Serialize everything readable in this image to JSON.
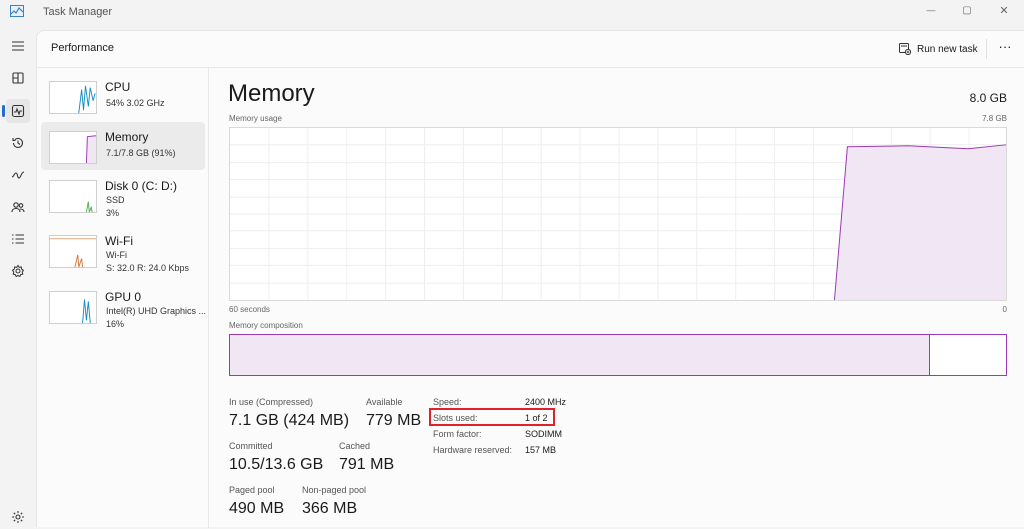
{
  "app": {
    "title": "Task Manager"
  },
  "window_controls": {
    "minimize": "—",
    "maximize": "▢",
    "close": "✕"
  },
  "nav": {
    "items": [
      {
        "name": "hamburger-menu-icon"
      },
      {
        "name": "processes-icon"
      },
      {
        "name": "performance-icon",
        "active": true
      },
      {
        "name": "app-history-icon"
      },
      {
        "name": "startup-apps-icon"
      },
      {
        "name": "users-icon"
      },
      {
        "name": "details-icon"
      },
      {
        "name": "services-icon"
      },
      {
        "name": "settings-icon"
      }
    ]
  },
  "header": {
    "title": "Performance",
    "run_new_task": "Run new task",
    "more": "···"
  },
  "sidebar": {
    "items": [
      {
        "name": "CPU",
        "sub1": "54%  3.02 GHz",
        "sub2": "",
        "color": "#1a8fc7"
      },
      {
        "name": "Memory",
        "sub1": "7.1/7.8 GB (91%)",
        "sub2": "",
        "color": "#9a3bb1",
        "selected": true
      },
      {
        "name": "Disk 0 (C: D:)",
        "sub1": "SSD",
        "sub2": "3%",
        "color": "#4caf50"
      },
      {
        "name": "Wi-Fi",
        "sub1": "Wi-Fi",
        "sub2": "S: 32.0  R: 24.0 Kbps",
        "color": "#d9773a"
      },
      {
        "name": "GPU 0",
        "sub1": "Intel(R) UHD Graphics ...",
        "sub2": "16%",
        "color": "#1a8fc7"
      }
    ]
  },
  "main": {
    "title": "Memory",
    "total": "8.0 GB",
    "usage_label": "Memory usage",
    "usage_max": "7.8 GB",
    "time_left": "60 seconds",
    "time_right": "0",
    "composition_label": "Memory composition",
    "composition_used_fraction": 0.902,
    "stats": {
      "in_use_label": "In use (Compressed)",
      "in_use_value": "7.1 GB (424 MB)",
      "available_label": "Available",
      "available_value": "779 MB",
      "committed_label": "Committed",
      "committed_value": "10.5/13.6 GB",
      "cached_label": "Cached",
      "cached_value": "791 MB",
      "paged_label": "Paged pool",
      "paged_value": "490 MB",
      "nonpaged_label": "Non-paged pool",
      "nonpaged_value": "366 MB"
    },
    "specs": {
      "speed_label": "Speed:",
      "speed_value": "2400 MHz",
      "slots_label": "Slots used:",
      "slots_value": "1 of 2",
      "form_label": "Form factor:",
      "form_value": "SODIMM",
      "reserved_label": "Hardware reserved:",
      "reserved_value": "157 MB"
    }
  },
  "colors": {
    "memory": "#9a3bb1",
    "accent": "#1f6fcf",
    "highlight": "#e0202a"
  }
}
